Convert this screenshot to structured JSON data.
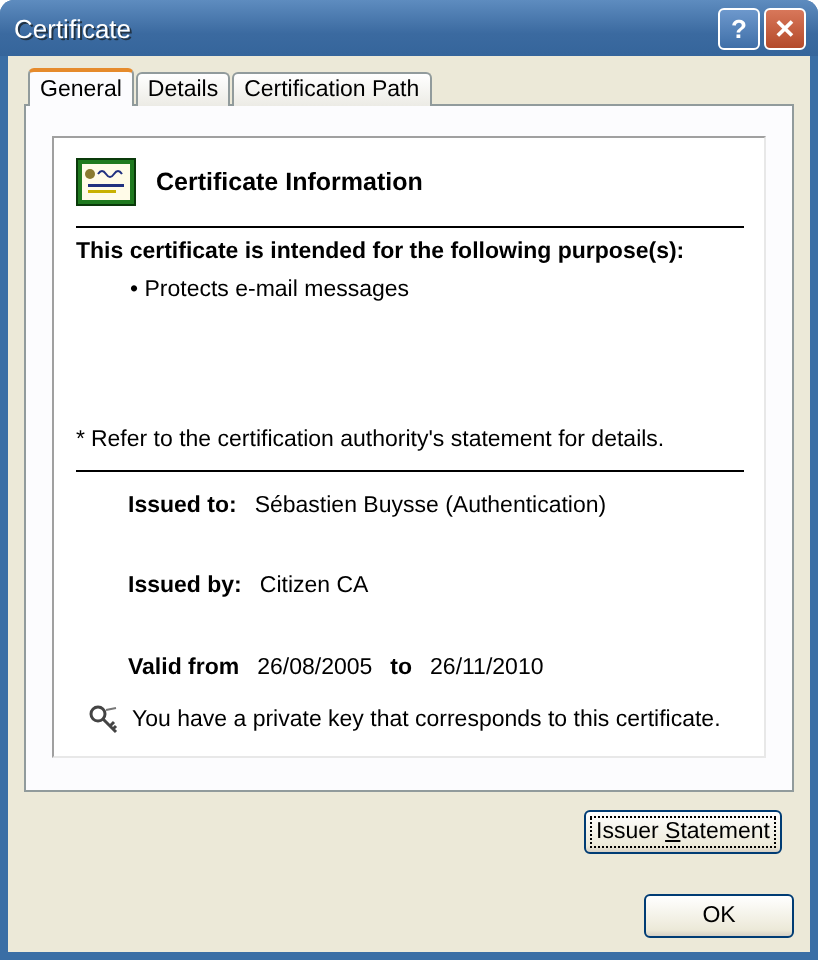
{
  "window": {
    "title": "Certificate",
    "help_glyph": "?",
    "close_glyph": "✕"
  },
  "tabs": [
    {
      "label": "General",
      "selected": true
    },
    {
      "label": "Details",
      "selected": false
    },
    {
      "label": "Certification Path",
      "selected": false
    }
  ],
  "info": {
    "heading": "Certificate Information",
    "purpose_title": "This certificate is intended for the following purpose(s):",
    "purposes": [
      {
        "bullet": "•",
        "text": "Protects e-mail messages"
      }
    ],
    "footnote_mark": "*",
    "footnote": "Refer to the certification authority's statement for details.",
    "issued_to_label": "Issued to:",
    "issued_to": "Sébastien Buysse (Authentication)",
    "issued_by_label": "Issued by:",
    "issued_by": "Citizen CA",
    "valid_from_label": "Valid from",
    "valid_from": "26/08/2005",
    "valid_to_label": "to",
    "valid_to": "26/11/2010",
    "key_note": "You have a private key that corresponds to this certificate."
  },
  "issuer_button": {
    "label_before": "Issuer ",
    "mnemonic": "S",
    "label_after": "tatement",
    "focused": true
  },
  "buttons": [
    "OK"
  ]
}
